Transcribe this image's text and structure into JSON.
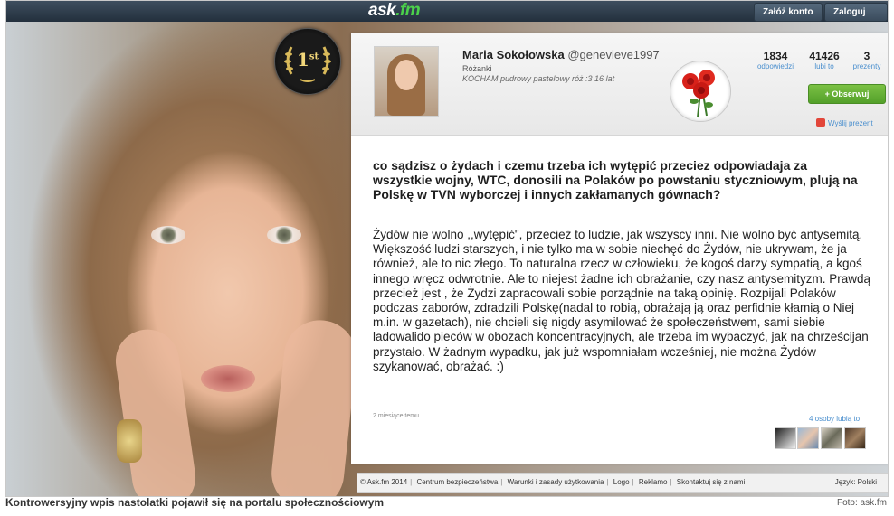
{
  "topbar": {
    "logo_main": "ask",
    "logo_fm": ".fm",
    "register_label": "Załóż konto",
    "login_label": "Zaloguj się"
  },
  "badge": {
    "text": "1",
    "sup": "st"
  },
  "profile": {
    "name": "Maria Sokołowska",
    "handle": "@genevieve1997",
    "location": "Różanki",
    "bio": "KOCHAM pudrowy pastelowy róż :3 16 lat",
    "stats": [
      {
        "value": "1834",
        "label": "odpowiedzi"
      },
      {
        "value": "41426",
        "label": "lubi to"
      },
      {
        "value": "3",
        "label": "prezenty"
      }
    ],
    "follow_label": "+ Obserwuj",
    "gift_label": "Wyślij prezent"
  },
  "post": {
    "question": "co sądzisz o żydach i czemu trzeba ich wytępić przeciez odpowiadaja za wszystkie wojny, WTC, donosili na Polaków po powstaniu styczniowym, plują na Polskę w TVN wyborczej i innych zakłamanych gównach?",
    "answer": "Żydów nie wolno ,,wytępić\", przecież to ludzie, jak wszyscy inni. Nie wolno być antysemitą. Większość ludzi starszych, i nie tylko ma w sobie niechęć do Żydów, nie ukrywam, że ja również, ale to nic złego. To naturalna rzecz w człowieku, że kogoś darzy sympatią, a kgoś innego wręcz odwrotnie. Ale to niejest żadne ich obrażanie, czy nasz antysemityzm. Prawdą przecież jest , że Żydzi zapracowali sobie porządnie na taką opinię. Rozpijali Polaków podczas zaborów, zdradzili Polskę(nadal to robią, obrażają ją oraz perfidnie kłamią o Niej m.in. w gazetach), nie chcieli się nigdy asymilować że społeczeństwem, sami siebie ladowalido pieców w obozach koncentracyjnych, ale trzeba im wybaczyć, jak na chrześcijan przystało. W żadnym wypadku, jak już wspomniałam wcześniej, nie można Żydów szykanować, obrażać. :)",
    "time": "2 miesiące temu",
    "likes": "4 osoby lubią to"
  },
  "footer": {
    "items": [
      "© Ask.fm 2014",
      "Centrum bezpieczeństwa",
      "Warunki i zasady użytkowania",
      "Logo",
      "Reklamo",
      "Skontaktuj się z nami"
    ],
    "language": "Język: Polski"
  },
  "caption": "Kontrowersyjny wpis nastolatki pojawił się na portalu społecznościowym",
  "credit": "Foto: ask.fm"
}
